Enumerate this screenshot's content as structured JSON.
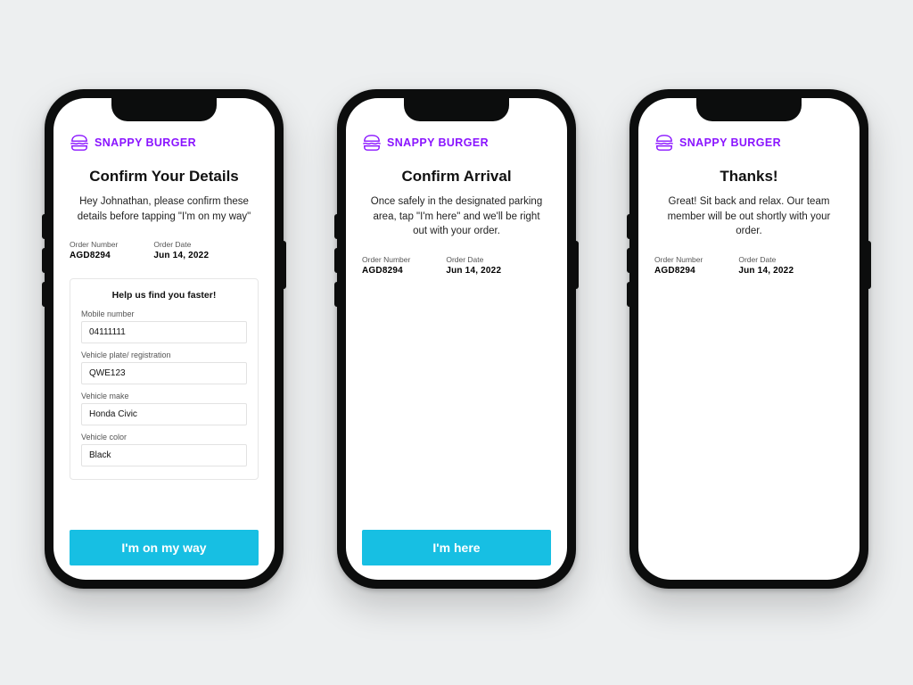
{
  "brand": {
    "name": "SNAPPY BURGER"
  },
  "colors": {
    "accent": "#8a14ff",
    "primaryButton": "#17bfe3"
  },
  "order": {
    "numberLabel": "Order Number",
    "numberValue": "AGD8294",
    "dateLabel": "Order Date",
    "dateValue": "Jun 14,  2022"
  },
  "screens": [
    {
      "title": "Confirm Your Details",
      "intro": "Hey Johnathan, please confirm these details before tapping \"I'm on my way\"",
      "form": {
        "heading": "Help us find you faster!",
        "fields": [
          {
            "label": "Mobile number",
            "value": "04111111"
          },
          {
            "label": "Vehicle plate/ registration",
            "value": "QWE123"
          },
          {
            "label": "Vehicle make",
            "value": "Honda Civic"
          },
          {
            "label": "Vehicle color",
            "value": "Black"
          }
        ]
      },
      "cta": "I'm on my way"
    },
    {
      "title": "Confirm Arrival",
      "intro": "Once safely in the designated parking area, tap \"I'm here\" and we'll be right out with your order.",
      "cta": "I'm here"
    },
    {
      "title": "Thanks!",
      "intro": "Great! Sit back and relax. Our team member will be out shortly with your order."
    }
  ]
}
